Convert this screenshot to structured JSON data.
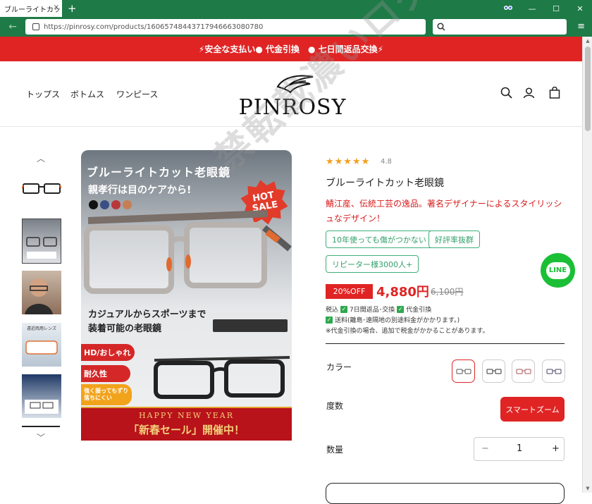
{
  "browser": {
    "tab_title": "ブルーライトカット老",
    "tab_close": "×",
    "new_tab": "+",
    "url": "https://pinrosy.com/products/1606574844371794666308078​0",
    "controls": [
      "—",
      "☐",
      "✕"
    ]
  },
  "promo_bar": {
    "text": "⚡安全な支払い● 代金引換　● 七日間返品交換⚡"
  },
  "header": {
    "nav": [
      "トップス",
      "ボトムス",
      "ワンピース"
    ],
    "logo_text": "PINROSY",
    "icons": [
      "search-icon",
      "account-icon",
      "cart-icon"
    ]
  },
  "gallery": {
    "up_arrow": "︿",
    "down_arrow": "﹀",
    "main_image": {
      "title": "ブルーライトカット老眼鏡",
      "subtitle": "親孝行は目のケアから!",
      "hot_badge": "HOT SALE",
      "caption_line1": "カジュアルからスポーツまで",
      "caption_line2": "装着可能の老眼鏡",
      "tags": [
        "HD/おしゃれ",
        "耐久性",
        "強く振ってもずり落ちにくい"
      ],
      "banner_top": "HAPPY NEW YEAR",
      "banner_main": "「新春セール」開催中！",
      "watermark": "禁転載濃いログ"
    },
    "thumbnail_texts": [
      "遠近両用レンズ"
    ]
  },
  "product": {
    "stars": "★★★★★",
    "rating": "4.8",
    "title": "ブルーライトカット老眼鏡",
    "description": "鯖江産、伝統工芸の逸品。著名デザイナーによるスタイリッシュなデザイン！",
    "badges": [
      "10年使っても傷がつかない",
      "好評率抜群",
      "リピーター様3000人+"
    ],
    "discount": "20%OFF",
    "price": "4,880円",
    "old_price": "6,100円",
    "info_line1_a": "税込",
    "info_line1_b": "7日間返品･交換",
    "info_line1_c": "代金引換",
    "info_line2": "送料(離島･遠隔地の別途料金がかかります。)",
    "info_line3": "※代金引換の場合、追加で税金がかかることがあります。",
    "color_label": "カラー",
    "power_label": "度数",
    "power_option": "スマートズーム",
    "qty_label": "数量",
    "qty_minus": "−",
    "qty_value": "1",
    "qty_plus": "+",
    "check_mark": "✓"
  },
  "line_button": {
    "label": "LINE"
  },
  "colors": {
    "accent": "#e02424",
    "browser": "#1e7a47",
    "badge_green": "#33a06b",
    "line_green": "#1bbf35"
  }
}
